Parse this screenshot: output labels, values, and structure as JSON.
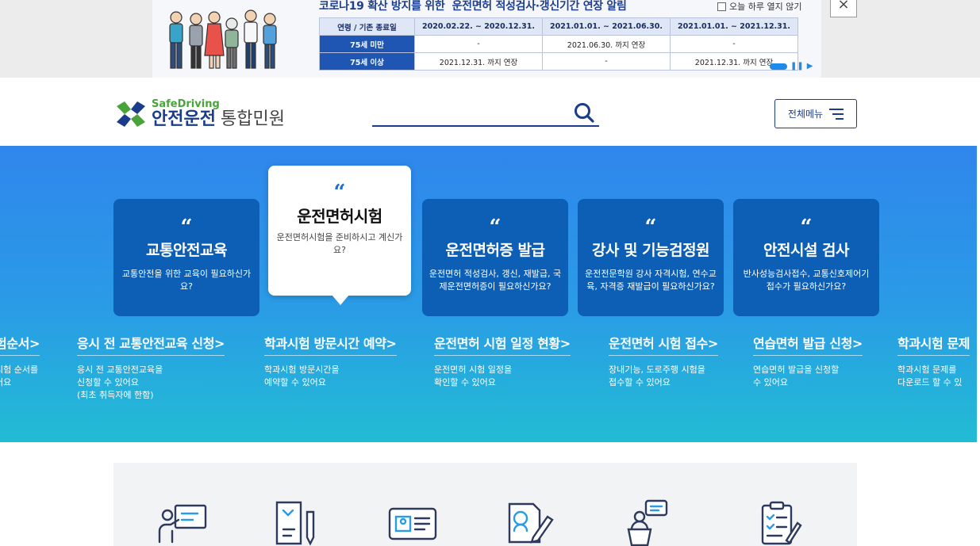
{
  "banner": {
    "title_prefix": "코로나19 확산 방지를 위한",
    "title_emphasis": "운전면허 적성검사·갱신기간 연장 알림",
    "table": {
      "header": [
        "연령 / 기존 종료일",
        "2020.02.22. ~ 2020.12.31.",
        "2021.01.01. ~ 2021.06.30.",
        "2021.01.01. ~ 2021.12.31."
      ],
      "rows": [
        [
          "75세 미만",
          "-",
          "2021.06.30. 까지 연장",
          "-"
        ],
        [
          "75세 이상",
          "2021.12.31. 까지 연장",
          "-",
          "2021.12.31. 까지 연장"
        ]
      ]
    },
    "no_today_label": "오늘 하루 열지 않기",
    "close_label": "×"
  },
  "header": {
    "logo_sub": "SafeDriving",
    "logo_main": "안전운전",
    "logo_light": "통합민원",
    "menu_label": "전체메뉴"
  },
  "cards": [
    {
      "quote": "“",
      "title": "교통안전교육",
      "desc": "교통안전을 위한 교육이 필요하신가요?"
    },
    {
      "quote": "“",
      "title": "운전면허시험",
      "desc": "운전면허시험을 준비하시고 계신가요?"
    },
    {
      "quote": "“",
      "title": "운전면허증 발급",
      "desc": "운전면허 적성검사, 갱신, 재발급, 국제운전면허증이 필요하신가요?"
    },
    {
      "quote": "“",
      "title": "강사 및 기능검정원",
      "desc": "운전전문학원 강사 자격시험, 연수교육, 자격증 재발급이 필요하신가요?"
    },
    {
      "quote": "“",
      "title": "안전시설 검사",
      "desc": "반사성능검사접수, 교통신호제어기 접수가 필요하신가요?"
    }
  ],
  "links": [
    {
      "title": "험순서>",
      "desc": "시험 순서를\n어요"
    },
    {
      "title": "응시 전 교통안전교육 신청>",
      "desc": "응시 전 교통안전교육을\n신청할 수 있어요\n(최초 취득자에 한함)"
    },
    {
      "title": "학과시험 방문시간 예약>",
      "desc": "학과시험 방문시간을\n예약할 수 있어요"
    },
    {
      "title": "운전면허 시험 일정 현황>",
      "desc": "운전면허 시험 일정을\n확인할 수 있어요"
    },
    {
      "title": "운전면허 시험 접수>",
      "desc": "장내기능, 도로주행 시험을\n접수할 수 있어요"
    },
    {
      "title": "연습면허 발급 신청>",
      "desc": "연습면허 발급을 신청할\n수 있어요"
    },
    {
      "title": "학과시험 문제",
      "desc": "학과시험 문제를\n다운로드 할 수 있"
    }
  ],
  "colors": {
    "brand_navy": "#1b3c8a",
    "brand_green": "#49a33a",
    "card_blue": "#0d5fb5",
    "hero_top": "#2f86ec",
    "hero_bottom": "#21bcd4"
  },
  "services": [
    {
      "icon": "presentation-teacher-icon"
    },
    {
      "icon": "document-pen-icon"
    },
    {
      "icon": "id-card-icon"
    },
    {
      "icon": "profile-signature-icon"
    },
    {
      "icon": "speaker-podium-icon"
    },
    {
      "icon": "clipboard-checklist-icon"
    }
  ]
}
